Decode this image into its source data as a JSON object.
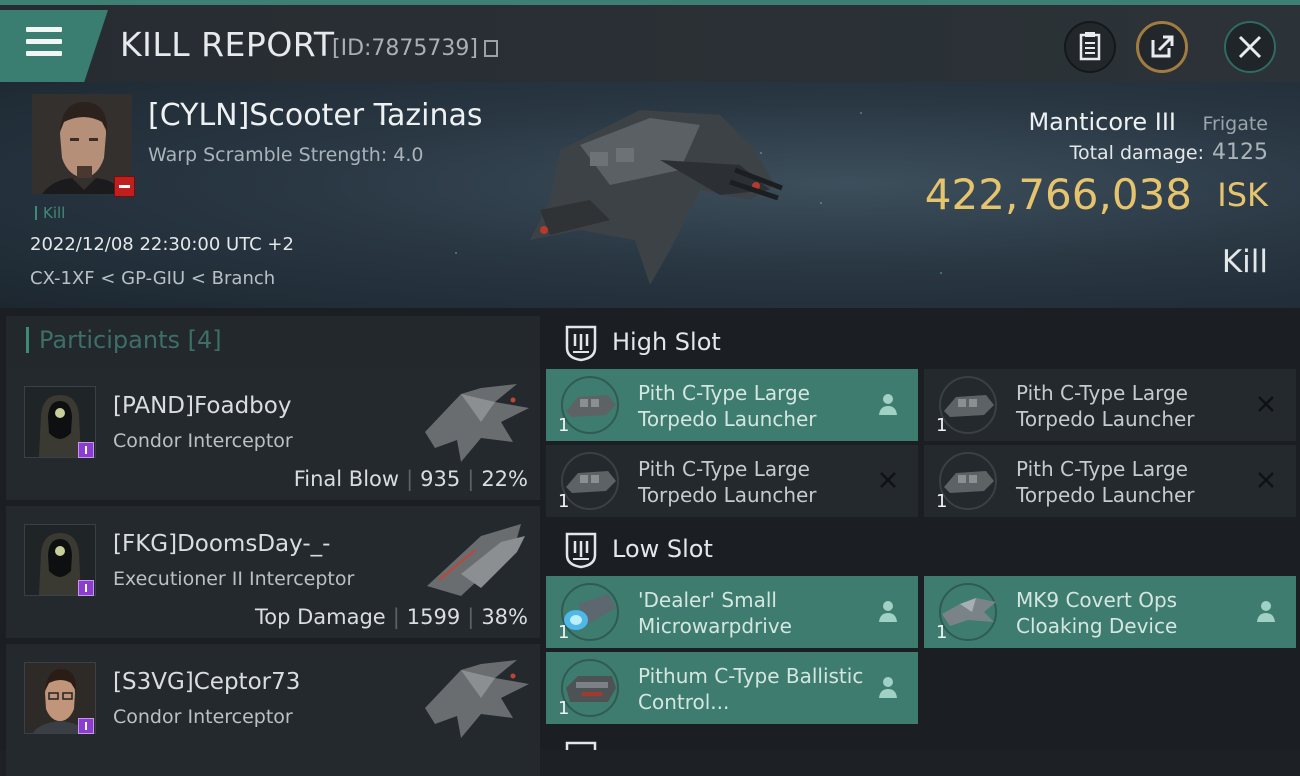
{
  "header": {
    "title": "KILL REPORT",
    "report_id": "[ID:7875739]"
  },
  "victim": {
    "name": "[CYLN]Scooter Tazinas",
    "warp_scramble": "Warp Scramble Strength: 4.0",
    "kill_tag": "Kill",
    "datetime": "2022/12/08 22:30:00 UTC +2",
    "location": "CX-1XF < GP-GIU < Branch",
    "ship_name": "Manticore III",
    "ship_class": "Frigate",
    "total_damage_label": "Total damage:",
    "total_damage": "4125",
    "isk_value": "422,766,038",
    "isk_unit": "ISK",
    "result": "Kill"
  },
  "participants": {
    "title": "Participants [4]",
    "items": [
      {
        "name": "[PAND]Foadboy",
        "ship": "Condor Interceptor",
        "label": "Final Blow",
        "damage": "935",
        "percent": "22%"
      },
      {
        "name": "[FKG]DoomsDay-_-",
        "ship": "Executioner II Interceptor",
        "label": "Top Damage",
        "damage": "1599",
        "percent": "38%"
      },
      {
        "name": "[S3VG]Ceptor73",
        "ship": "Condor Interceptor",
        "label": "",
        "damage": "",
        "percent": ""
      }
    ]
  },
  "slots": {
    "high": {
      "title": "High Slot",
      "modules": [
        {
          "name": "Pith C-Type Large Torpedo Launcher",
          "qty": "1",
          "status": "dropped"
        },
        {
          "name": "Pith C-Type Large Torpedo Launcher",
          "qty": "1",
          "status": "destroyed"
        },
        {
          "name": "Pith C-Type Large Torpedo Launcher",
          "qty": "1",
          "status": "destroyed"
        },
        {
          "name": "Pith C-Type Large Torpedo Launcher",
          "qty": "1",
          "status": "destroyed"
        }
      ]
    },
    "low": {
      "title": "Low Slot",
      "modules": [
        {
          "name": "'Dealer' Small Microwarpdrive",
          "qty": "1",
          "status": "dropped"
        },
        {
          "name": "MK9 Covert Ops Cloaking Device",
          "qty": "1",
          "status": "dropped"
        },
        {
          "name": "Pithum C-Type Ballistic Control...",
          "qty": "1",
          "status": "dropped"
        }
      ]
    }
  },
  "colors": {
    "accent": "#3e7c6f",
    "isk": "#e6c36d",
    "badge": "#8a3dce",
    "loss": "#c11e1e"
  }
}
